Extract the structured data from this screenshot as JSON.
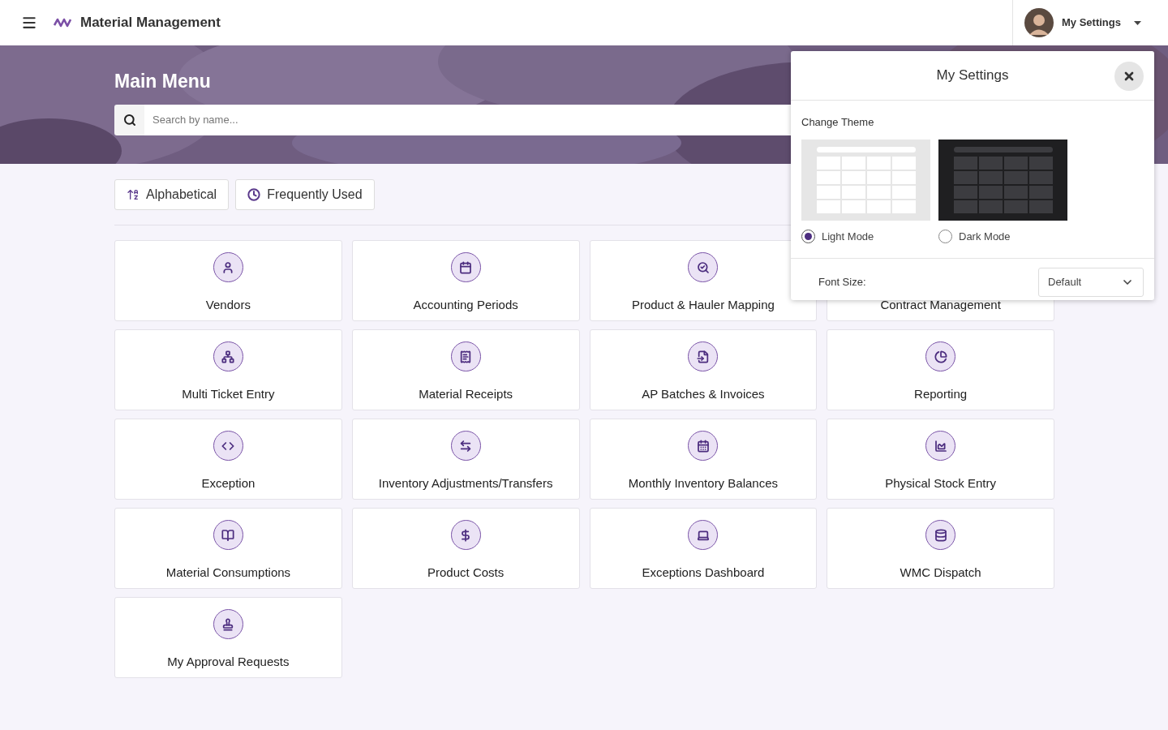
{
  "header": {
    "app_title": "Material Management",
    "user_menu": "My Settings"
  },
  "hero": {
    "title": "Main Menu",
    "search": {
      "placeholder": "Search by name..."
    }
  },
  "sort_buttons": [
    "Alphabetical",
    "Frequently Used"
  ],
  "tiles": [
    "Vendors",
    "Accounting Periods",
    "Product & Hauler Mapping",
    "Contract Management",
    "Multi Ticket Entry",
    "Material Receipts",
    "AP Batches & Invoices",
    "Reporting",
    "Exception",
    "Inventory Adjustments/Transfers",
    "Monthly Inventory Balances",
    "Physical Stock Entry",
    "Material Consumptions",
    "Product Costs",
    "Exceptions Dashboard",
    "WMC Dispatch",
    "My Approval Requests"
  ],
  "settings_popup": {
    "title": "My Settings",
    "section_label": "Change Theme",
    "themes": [
      {
        "label": "Light Mode",
        "kind": "light",
        "selected": true
      },
      {
        "label": "Dark Mode",
        "kind": "dark",
        "selected": false
      }
    ],
    "font_size": {
      "label": "Font Size:",
      "value": "Default"
    }
  }
}
